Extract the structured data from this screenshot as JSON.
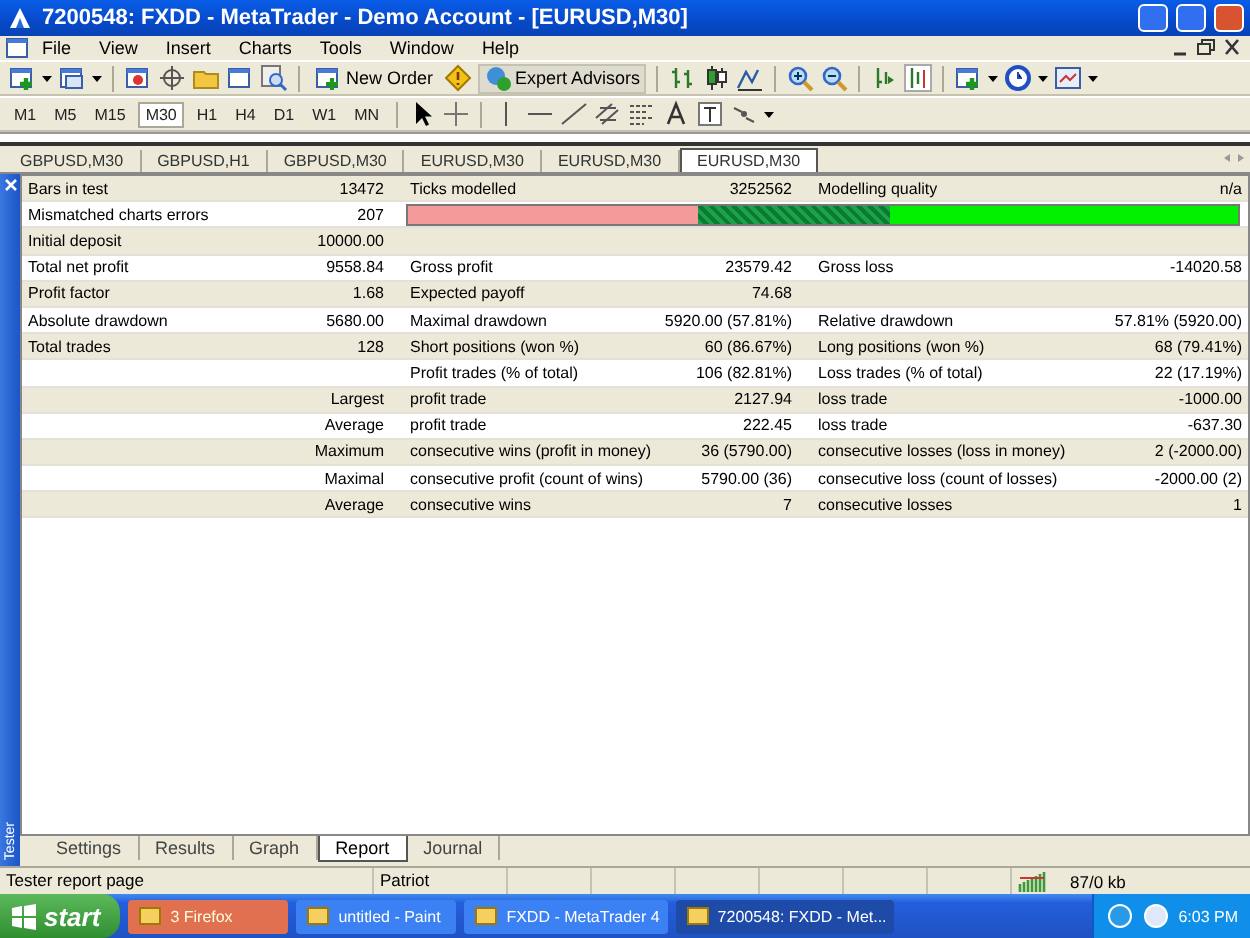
{
  "window": {
    "title": "7200548: FXDD - MetaTrader - Demo Account - [EURUSD,M30]"
  },
  "menu": [
    "File",
    "View",
    "Insert",
    "Charts",
    "Tools",
    "Window",
    "Help"
  ],
  "toolbar": {
    "buttons": [
      {
        "label": "New Order"
      },
      {
        "label": "Expert Advisors"
      }
    ]
  },
  "periods": [
    {
      "label": "M1",
      "selected": false
    },
    {
      "label": "M5",
      "selected": false
    },
    {
      "label": "M15",
      "selected": false
    },
    {
      "label": "M30",
      "selected": true
    },
    {
      "label": "H1",
      "selected": false
    },
    {
      "label": "H4",
      "selected": false
    },
    {
      "label": "D1",
      "selected": false
    },
    {
      "label": "W1",
      "selected": false
    },
    {
      "label": "MN",
      "selected": false
    }
  ],
  "chart_tabs": [
    {
      "label": "GBPUSD,M30",
      "selected": false
    },
    {
      "label": "GBPUSD,H1",
      "selected": false
    },
    {
      "label": "GBPUSD,M30",
      "selected": false
    },
    {
      "label": "EURUSD,M30",
      "selected": false
    },
    {
      "label": "EURUSD,M30",
      "selected": false
    },
    {
      "label": "EURUSD,M30",
      "selected": true
    }
  ],
  "report": {
    "rows": [
      {
        "kind": "text",
        "col_1": "Bars in test",
        "col_2": "13472",
        "col_3": "Ticks modelled",
        "col_4": "3252562",
        "col_5": "Modelling quality",
        "col_6": "n/a"
      },
      {
        "kind": "quality_bar",
        "col_1": "Mismatched charts errors",
        "col_2": "207"
      },
      {
        "kind": "text",
        "col_1": "Initial deposit",
        "col_2": "10000.00"
      },
      {
        "kind": "text",
        "col_1": "Total net profit",
        "col_2": "9558.84",
        "col_3": "Gross profit",
        "col_4": "23579.42",
        "col_5": "Gross loss",
        "col_6": "-14020.58"
      },
      {
        "kind": "text",
        "col_1": "Profit factor",
        "col_2": "1.68",
        "col_3": "Expected payoff",
        "col_4": "74.68"
      },
      {
        "kind": "text",
        "col_1": "Absolute drawdown",
        "col_2": "5680.00",
        "col_3": "Maximal drawdown",
        "col_4": "5920.00 (57.81%)",
        "col_5": "Relative drawdown",
        "col_6": "57.81% (5920.00)"
      },
      {
        "kind": "text",
        "col_1": "Total trades",
        "col_2": "128",
        "col_3": "Short positions (won %)",
        "col_4": "60 (86.67%)",
        "col_5": "Long positions (won %)",
        "col_6": "68 (79.41%)"
      },
      {
        "kind": "text",
        "col_3": "Profit trades (% of total)",
        "col_4": "106 (82.81%)",
        "col_5": "Loss trades (% of total)",
        "col_6": "22 (17.19%)"
      },
      {
        "kind": "text",
        "col_2": "Largest",
        "col_3": "profit trade",
        "col_4": "2127.94",
        "col_5": "loss trade",
        "col_6": "-1000.00"
      },
      {
        "kind": "text",
        "col_2": "Average",
        "col_3": "profit trade",
        "col_4": "222.45",
        "col_5": "loss trade",
        "col_6": "-637.30"
      },
      {
        "kind": "text",
        "col_2": "Maximum",
        "col_3": "consecutive wins (profit in money)",
        "col_4": "36 (5790.00)",
        "col_5": "consecutive losses (loss in money)",
        "col_6": "2 (-2000.00)"
      },
      {
        "kind": "text",
        "col_2": "Maximal",
        "col_3": "consecutive profit (count of wins)",
        "col_4": "5790.00 (36)",
        "col_5": "consecutive loss (count of losses)",
        "col_6": "-2000.00 (2)"
      },
      {
        "kind": "text",
        "col_2": "Average",
        "col_3": "consecutive wins",
        "col_4": "7",
        "col_5": "consecutive losses",
        "col_6": "1"
      }
    ]
  },
  "panel": {
    "title": "Tester"
  },
  "tester_tabs": [
    {
      "label": "Settings",
      "selected": false
    },
    {
      "label": "Results",
      "selected": false
    },
    {
      "label": "Graph",
      "selected": false
    },
    {
      "label": "Report",
      "selected": true
    },
    {
      "label": "Journal",
      "selected": false
    }
  ],
  "status_bar": {
    "message": "Tester report page",
    "profile": "Patriot",
    "traffic": "87/0 kb"
  },
  "taskbar": {
    "start": "start",
    "items": [
      {
        "label": "3 Firefox",
        "highlighted": true,
        "selected": false
      },
      {
        "label": "untitled - Paint",
        "highlighted": false,
        "selected": false
      },
      {
        "label": "FXDD - MetaTrader 4",
        "highlighted": false,
        "selected": false
      },
      {
        "label": "7200548: FXDD - Met...",
        "highlighted": false,
        "selected": true
      }
    ],
    "clock": "6:03 PM"
  }
}
